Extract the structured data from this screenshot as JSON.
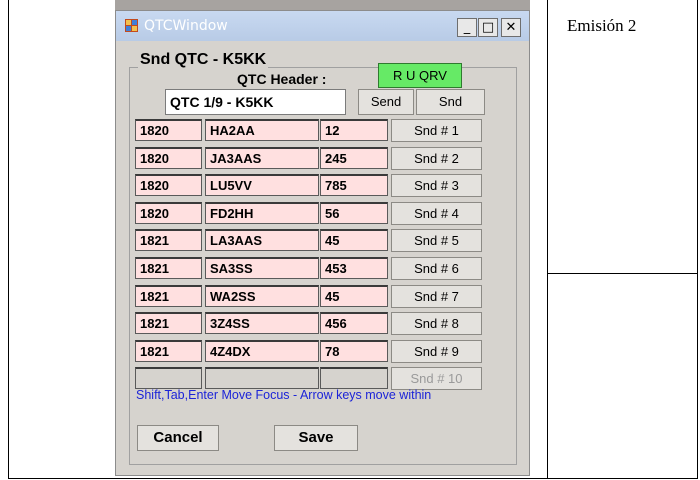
{
  "caption": "Emisión 2",
  "window": {
    "title": "QTCWindow",
    "minimize_glyph": "_",
    "maximize_glyph": "□",
    "close_glyph": "✕"
  },
  "group": {
    "label": "Snd QTC - K5KK",
    "header_label": "QTC Header :",
    "header_value": "QTC 1/9 - K5KK",
    "ruqrv_label": "R U QRV",
    "send_label": "Send",
    "snd_label": "Snd"
  },
  "rows": [
    {
      "time": "1820",
      "call": "HA2AA",
      "nr": "12",
      "btn": "Snd # 1"
    },
    {
      "time": "1820",
      "call": "JA3AAS",
      "nr": "245",
      "btn": "Snd # 2"
    },
    {
      "time": "1820",
      "call": "LU5VV",
      "nr": "785",
      "btn": "Snd # 3"
    },
    {
      "time": "1820",
      "call": "FD2HH",
      "nr": "56",
      "btn": "Snd # 4"
    },
    {
      "time": "1821",
      "call": "LA3AAS",
      "nr": "45",
      "btn": "Snd # 5"
    },
    {
      "time": "1821",
      "call": "SA3SS",
      "nr": "453",
      "btn": "Snd # 6"
    },
    {
      "time": "1821",
      "call": "WA2SS",
      "nr": "45",
      "btn": "Snd # 7"
    },
    {
      "time": "1821",
      "call": "3Z4SS",
      "nr": "456",
      "btn": "Snd # 8"
    },
    {
      "time": "1821",
      "call": "4Z4DX",
      "nr": "78",
      "btn": "Snd # 9"
    },
    {
      "time": "",
      "call": "",
      "nr": "",
      "btn": "Snd # 10"
    }
  ],
  "hint": "Shift,Tab,Enter Move Focus - Arrow keys move within",
  "cancel_label": "Cancel",
  "save_label": "Save",
  "colors": {
    "row_fill": "#ffe0e0",
    "ruqrv_fill": "#66ea66",
    "hint_text": "#1c24d8"
  }
}
